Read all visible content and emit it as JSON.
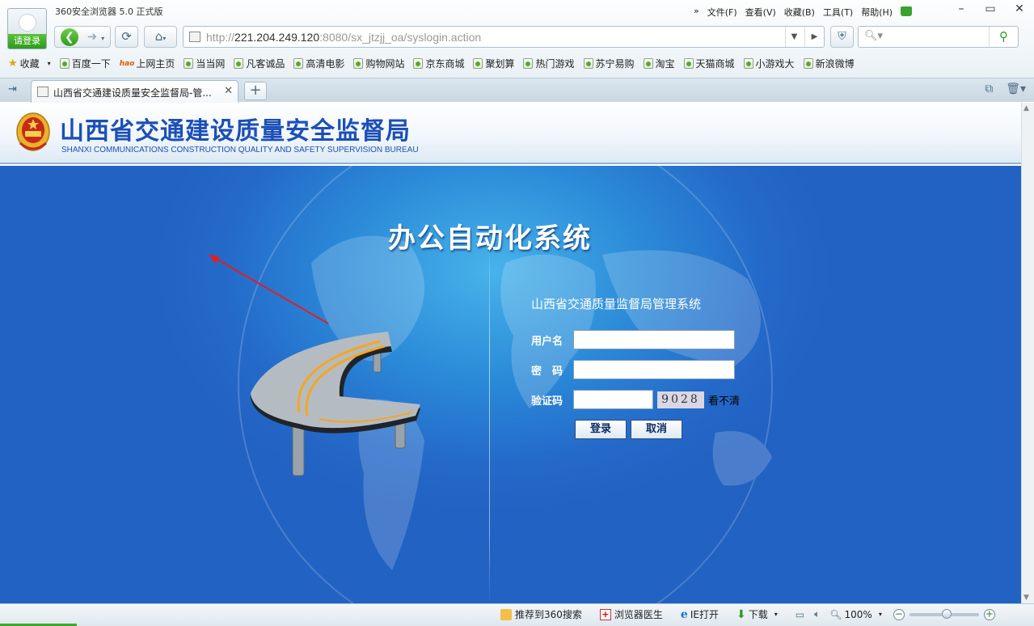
{
  "browser": {
    "app_title": "360安全浏览器 5.0 正式版",
    "login_label": "请登录",
    "menu": [
      "文件(F)",
      "查看(V)",
      "收藏(B)",
      "工具(T)",
      "帮助(H)"
    ],
    "menu_more": "»",
    "window_controls": [
      "–",
      "▭",
      "✕"
    ],
    "url_host": "http://",
    "url_ip": "221.204.249.120",
    "url_rest": ":8080/sx_jtzjj_oa/syslogin.action",
    "search_placeholder": "",
    "bookmarks_label": "收藏",
    "bookmarks": [
      "百度一下",
      "上网主页",
      "当当网",
      "凡客诚品",
      "高清电影",
      "购物网站",
      "京东商城",
      "聚划算",
      "热门游戏",
      "苏宁易购",
      "淘宝",
      "天猫商城",
      "小游戏大",
      "新浪微博"
    ],
    "tab_title": "山西省交通建设质量安全监督局-管...",
    "status": {
      "recommend": "推荐到360搜索",
      "doctor": "浏览器医生",
      "ie_open": "IE打开",
      "download": "下载",
      "zoom": "100%"
    }
  },
  "site": {
    "title": "山西省交通建设质量安全监督局",
    "subtitle": "SHANXI COMMUNICATIONS CONSTRUCTION QUALITY AND SAFETY SUPERVISION BUREAU",
    "system_title": "办公自动化系统",
    "login": {
      "heading": "山西省交通质量监督局管理系统",
      "username_label": "用户名",
      "password_label": "密　码",
      "captcha_label": "验证码",
      "username_value": "",
      "password_value": "",
      "captcha_value": "",
      "captcha_text": "9028",
      "refresh_label": "看不清",
      "submit_label": "登录",
      "cancel_label": "取消"
    }
  },
  "colors": {
    "title_blue": "#1b4fb8",
    "background_blue": "#2469c9",
    "annotation_arrow": "#e02020"
  }
}
